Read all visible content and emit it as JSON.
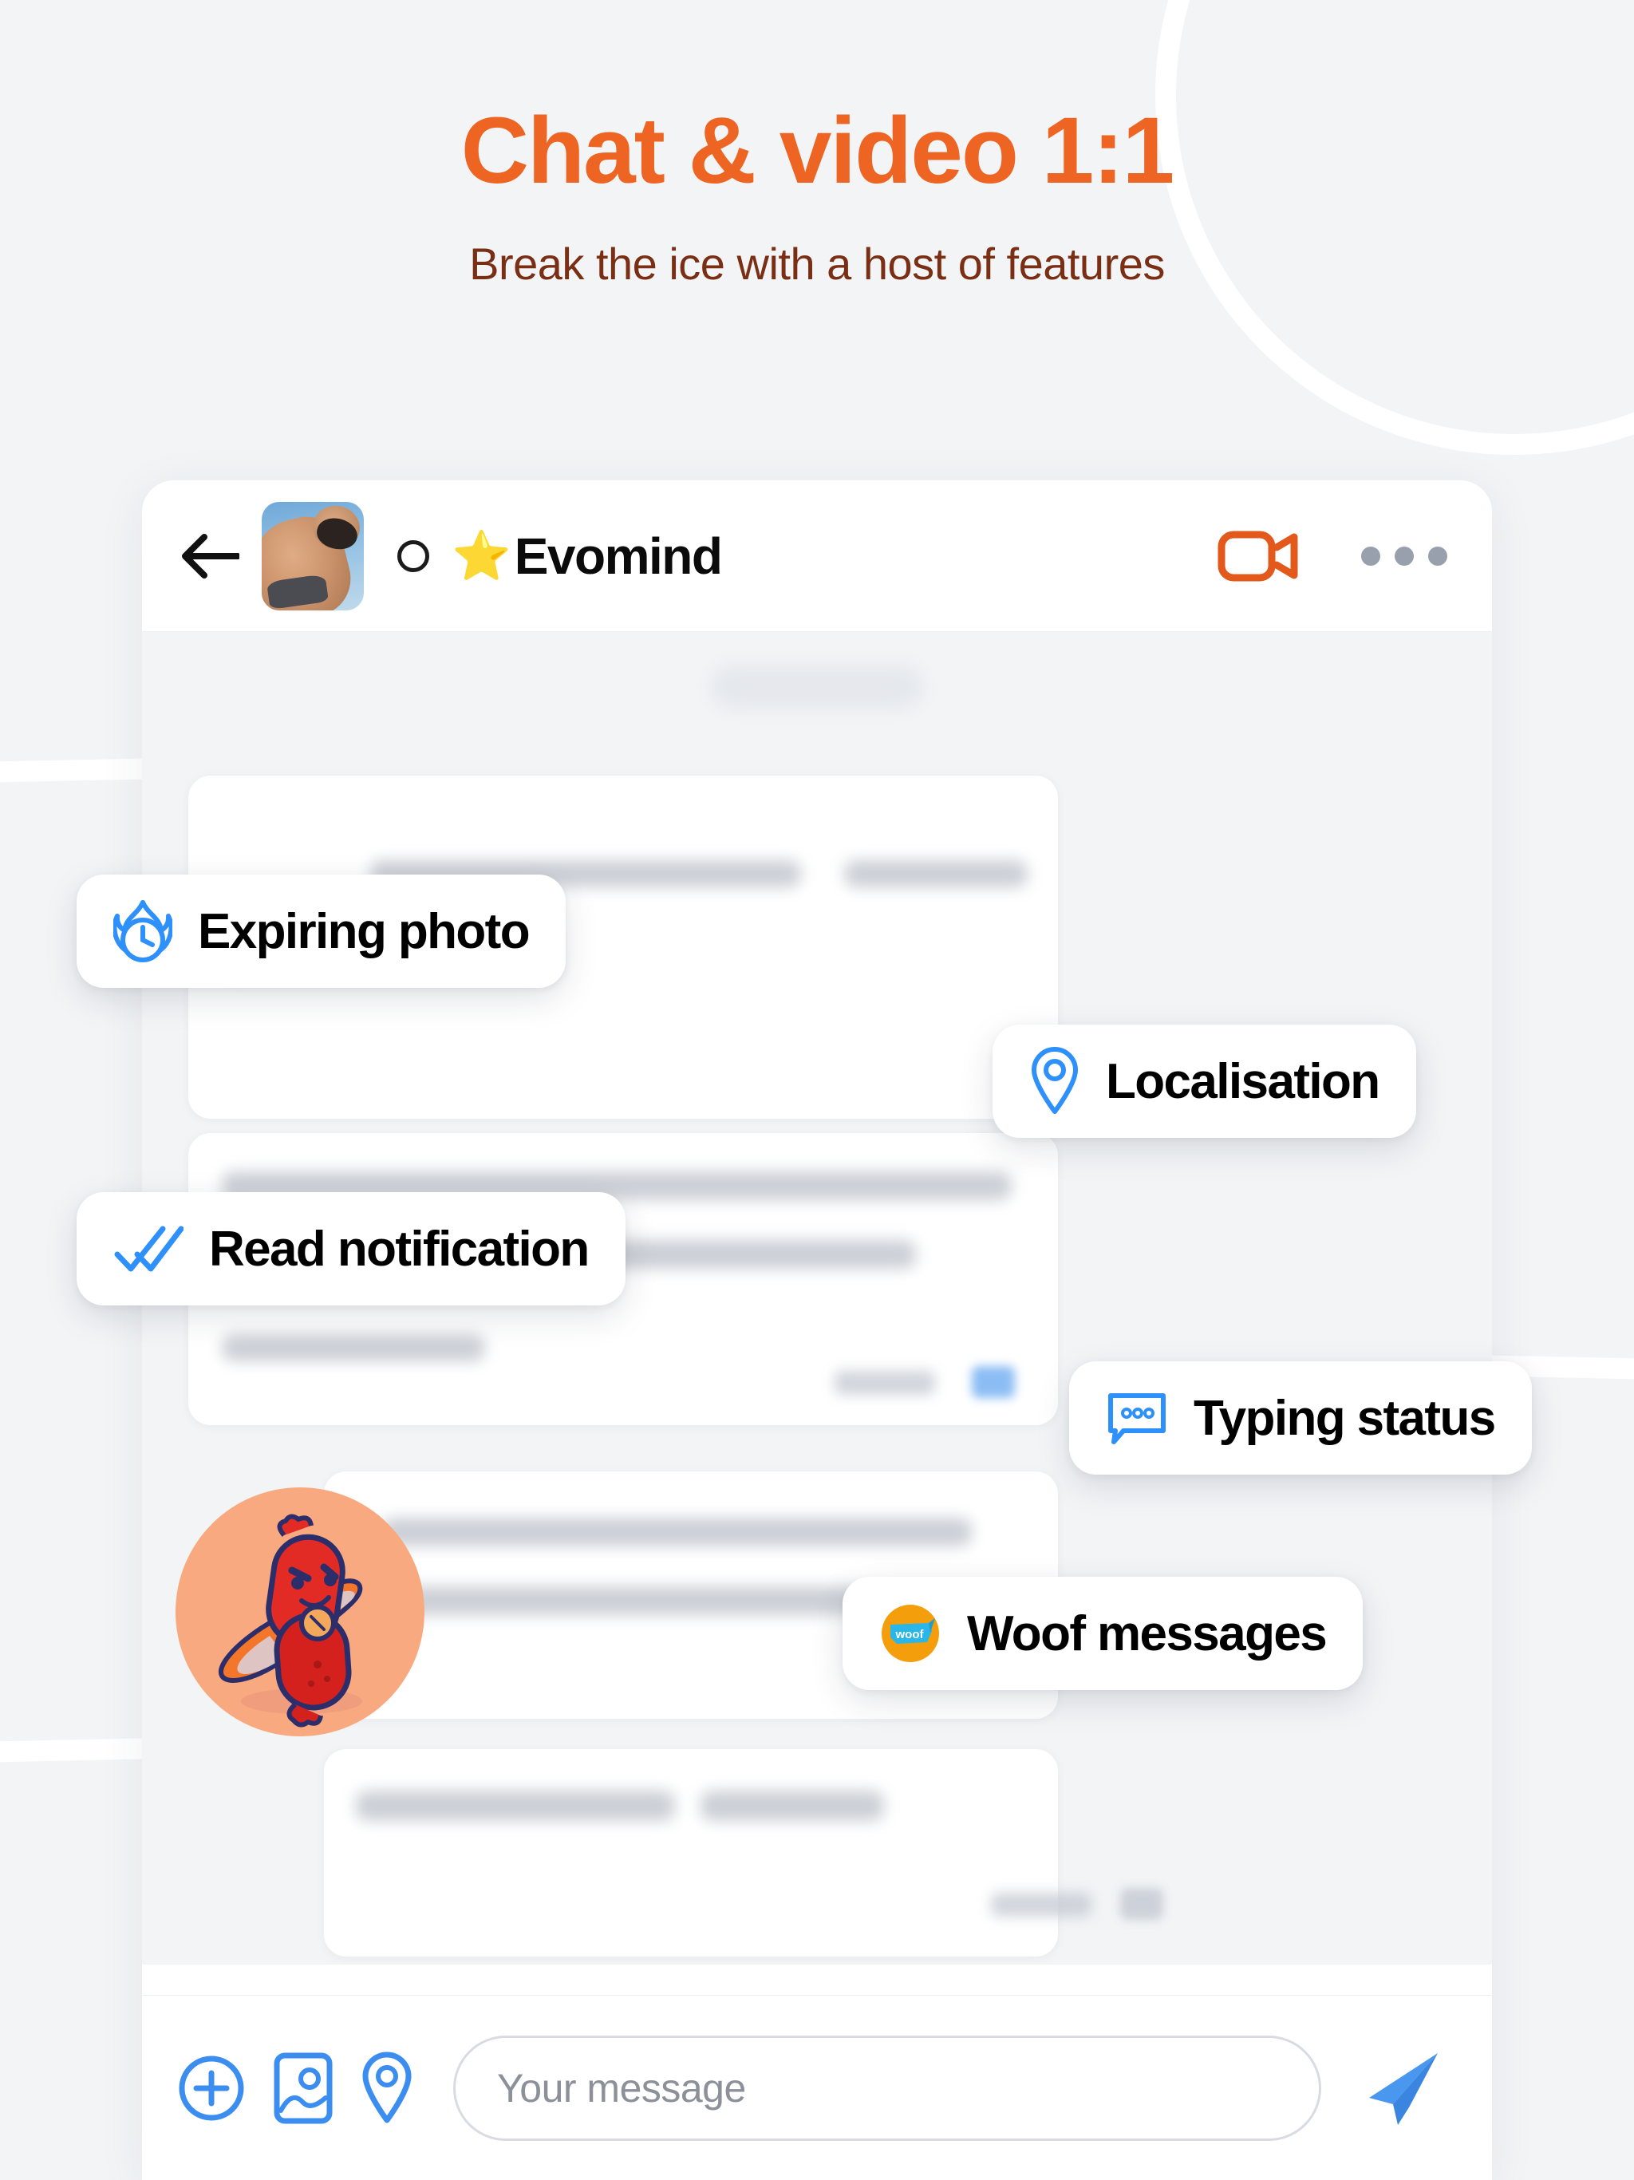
{
  "page": {
    "title": "Chat & video 1:1",
    "subtitle": "Break the ice with a host of features"
  },
  "colors": {
    "accent_orange": "#EE6422",
    "subtitle_brown": "#7A2F14",
    "pill_icon_blue": "#2E90FA",
    "woof_orange": "#F59E0B",
    "send_blue": "#4A97F0",
    "page_background": "#F2F4F6",
    "mascot_background": "#F9A97F"
  },
  "chat": {
    "header": {
      "back_icon": "back-arrow-icon",
      "avatar_alt": "profile-photo",
      "status_icon": "status-ring-icon",
      "badge_glyph": "⭐",
      "name": "Evomind",
      "video_icon": "video-camera-icon",
      "more_icon": "more-options-icon"
    },
    "conversation": {
      "date_separator": "",
      "messages": [
        {
          "side": "incoming",
          "text": ""
        },
        {
          "side": "incoming",
          "text": ""
        },
        {
          "side": "outgoing",
          "text": ""
        },
        {
          "side": "incoming",
          "text": ""
        },
        {
          "side": "outgoing",
          "text": ""
        }
      ]
    },
    "input": {
      "add_icon": "plus-circle-icon",
      "photo_icon": "image-icon",
      "location_icon": "location-pin-icon",
      "placeholder": "Your message",
      "value": "",
      "send_icon": "send-paper-plane-icon"
    }
  },
  "features": [
    {
      "id": "expiring",
      "label": "Expiring photo",
      "icon": "flame-clock-icon"
    },
    {
      "id": "localisation",
      "label": "Localisation",
      "icon": "location-pin-icon"
    },
    {
      "id": "read",
      "label": "Read notification",
      "icon": "double-check-icon"
    },
    {
      "id": "typing",
      "label": "Typing status",
      "icon": "typing-bubble-icon"
    },
    {
      "id": "woof",
      "label": "Woof messages",
      "icon": "woof-badge-icon"
    }
  ]
}
